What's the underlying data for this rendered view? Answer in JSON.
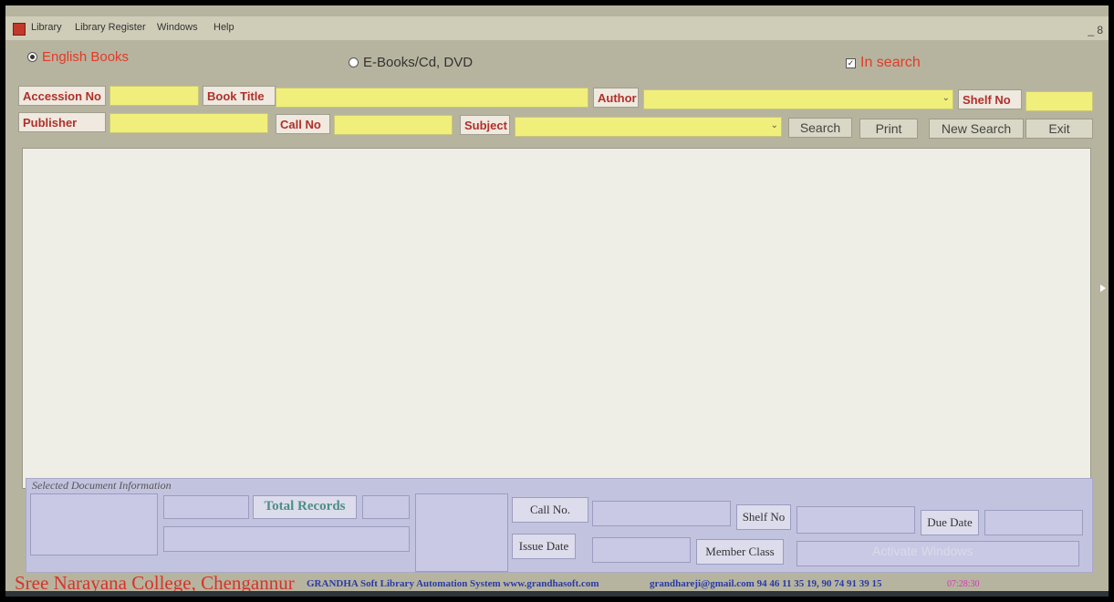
{
  "menu": {
    "items": [
      "Library",
      "Library Register",
      "Windows",
      "Help"
    ],
    "window_controls": "_ 8"
  },
  "search_mode": {
    "english_books": "English Books",
    "ebooks": "E-Books/Cd, DVD",
    "in_search": "In search",
    "in_search_checked": true,
    "selected": "english_books"
  },
  "fields": {
    "accession_no": "Accession No",
    "book_title": "Book Title",
    "author": "Author",
    "shelf_no": "Shelf No",
    "publisher": "Publisher",
    "call_no": "Call No",
    "subject": "Subject"
  },
  "buttons": {
    "search": "Search",
    "print": "Print",
    "new_search": "New Search",
    "exit": "Exit"
  },
  "info_panel": {
    "caption": "Selected Document Information",
    "total_records": "Total Records",
    "call_no": "Call No.",
    "shelf_no": "Shelf No",
    "due_date": "Due Date",
    "issue_date": "Issue Date",
    "member_class": "Member  Class"
  },
  "footer": {
    "college": "Sree Narayana College, Chengannur",
    "system": "GRANDHA Soft Library Automation System  www.grandhasoft.com",
    "contact": "grandhareji@gmail.com 94 46 11 35 19, 90 74 91 39 15",
    "time": "07:28:30"
  },
  "watermark": "Activate Windows",
  "colors": {
    "window_bg": "#b6b49e",
    "field_yellow": "#f1ef7c",
    "label_red": "#b0302a",
    "info_panel": "#c2c3df"
  }
}
